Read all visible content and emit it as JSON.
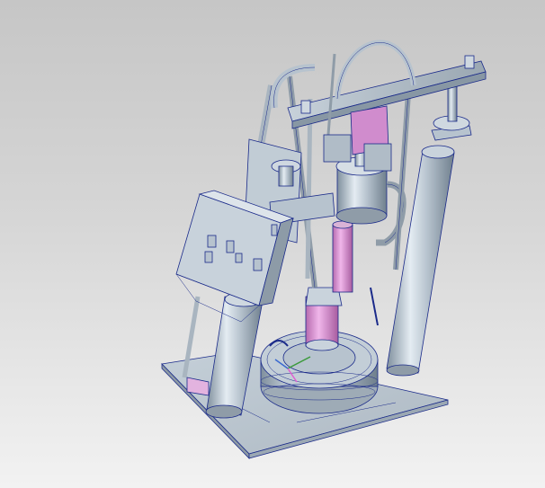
{
  "scene": {
    "subject": "CAD 3D render",
    "colors": {
      "background_top": "#c6c6c6",
      "background_bottom": "#f2f2f2",
      "metal": "#b7c3ce",
      "metal_shadow": "#7f8f9d",
      "edge_lines": "#1a2a8a",
      "pink_part": "#d78fd0",
      "magenta_highlight": "#e060d0"
    }
  }
}
